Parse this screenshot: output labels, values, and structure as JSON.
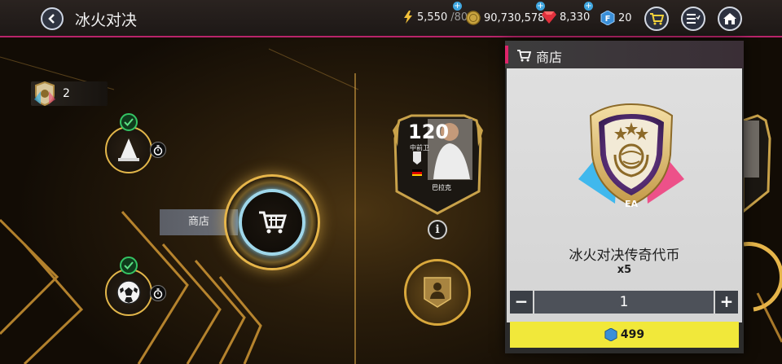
{
  "header": {
    "title": "冰火对决",
    "energy": {
      "current": "5,550",
      "max": "/80"
    },
    "coins": "90,730,578",
    "gems": "8,330",
    "fifa_points": "20",
    "plus_symbol": "+"
  },
  "tokens": {
    "count": "2"
  },
  "map": {
    "shop_label": "商店"
  },
  "player": {
    "rating": "120",
    "position": "中前卫",
    "name": "巴拉克",
    "info_symbol": "i"
  },
  "shop_panel": {
    "title": "商店",
    "item_name": "冰火对决传奇代币",
    "item_quantity": "x5",
    "quantity_value": "1",
    "minus_label": "−",
    "plus_label": "+",
    "price": "499"
  },
  "colors": {
    "accent_pink": "#e0246a",
    "gold": "#e6b54a",
    "buy_yellow": "#f1e83a",
    "check_green": "#34c464"
  },
  "icons": [
    "back-arrow-icon",
    "lightning-icon",
    "coin-icon",
    "gem-icon",
    "fifa-points-icon",
    "shopping-cart-icon",
    "list-menu-icon",
    "home-icon",
    "token-icon",
    "cone-icon",
    "soccer-ball-icon",
    "stopwatch-icon",
    "checkmark-icon",
    "info-icon",
    "player-silhouette-icon",
    "legend-token-badge-icon"
  ]
}
